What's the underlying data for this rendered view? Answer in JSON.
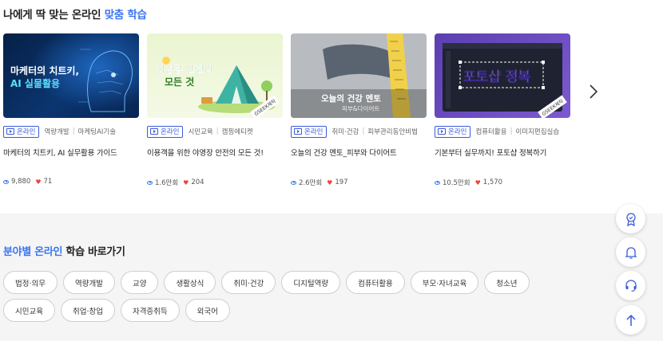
{
  "header": {
    "title_main": "나에게 딱 맞는 온라인 ",
    "title_accent": "맞춤 학습"
  },
  "cards": [
    {
      "thumb_line1": "마케터의 치트키,",
      "thumb_line2": "AI 실물활용",
      "badge": "온라인",
      "cat1": "역량개발",
      "cat2": "마케팅AI기술",
      "title": "마케터의 치트키, AI 실무활용 가이드",
      "views": "9,880",
      "likes": "71"
    },
    {
      "thumb_line1": "야영장 안전의",
      "thumb_line2": "모든 것",
      "badge": "온라인",
      "cat1": "시민교육",
      "cat2": "캠핑에티켓",
      "title": "이용객을 위한 야영장 안전의 모든 것!",
      "views": "1.6만회",
      "likes": "204"
    },
    {
      "thumb_line1": "오늘의 건강 멘토",
      "thumb_line2": "피부&다이어트",
      "badge": "온라인",
      "cat1": "취미·건강",
      "cat2": "피부관리동안비법",
      "title": "오늘의 건강 멘토_피부와 다이어트",
      "views": "2.6만회",
      "likes": "197"
    },
    {
      "thumb_line1": "포토샵 정복",
      "thumb_line2": "",
      "badge": "온라인",
      "cat1": "컴퓨터활용",
      "cat2": "이미지편집실습",
      "title": "기본부터 실무까지! 포토샵 정복하기",
      "views": "10.5만회",
      "likes": "1,570"
    }
  ],
  "thumb_brand": "GSEEK제작",
  "categories": {
    "title_accent": "분야별 온라인",
    "title_main": " 학습 바로가기",
    "row1": [
      "법정·의무",
      "역량개발",
      "교양",
      "생활상식",
      "취미·건강",
      "디지털역량",
      "컴퓨터활용",
      "부모·자녀교육",
      "청소년"
    ],
    "row2": [
      "시민교육",
      "취업·창업",
      "자격증취득",
      "외국어"
    ]
  },
  "colors": {
    "accent": "#3a76f0",
    "badge": "#3a5bd9",
    "heart": "#e8453c",
    "section_bg": "#f5f5f5"
  },
  "icons": [
    "eye-icon",
    "heart-icon",
    "play-icon",
    "chevron-right-icon",
    "certificate-icon",
    "bell-icon",
    "headset-icon",
    "arrow-up-icon"
  ]
}
